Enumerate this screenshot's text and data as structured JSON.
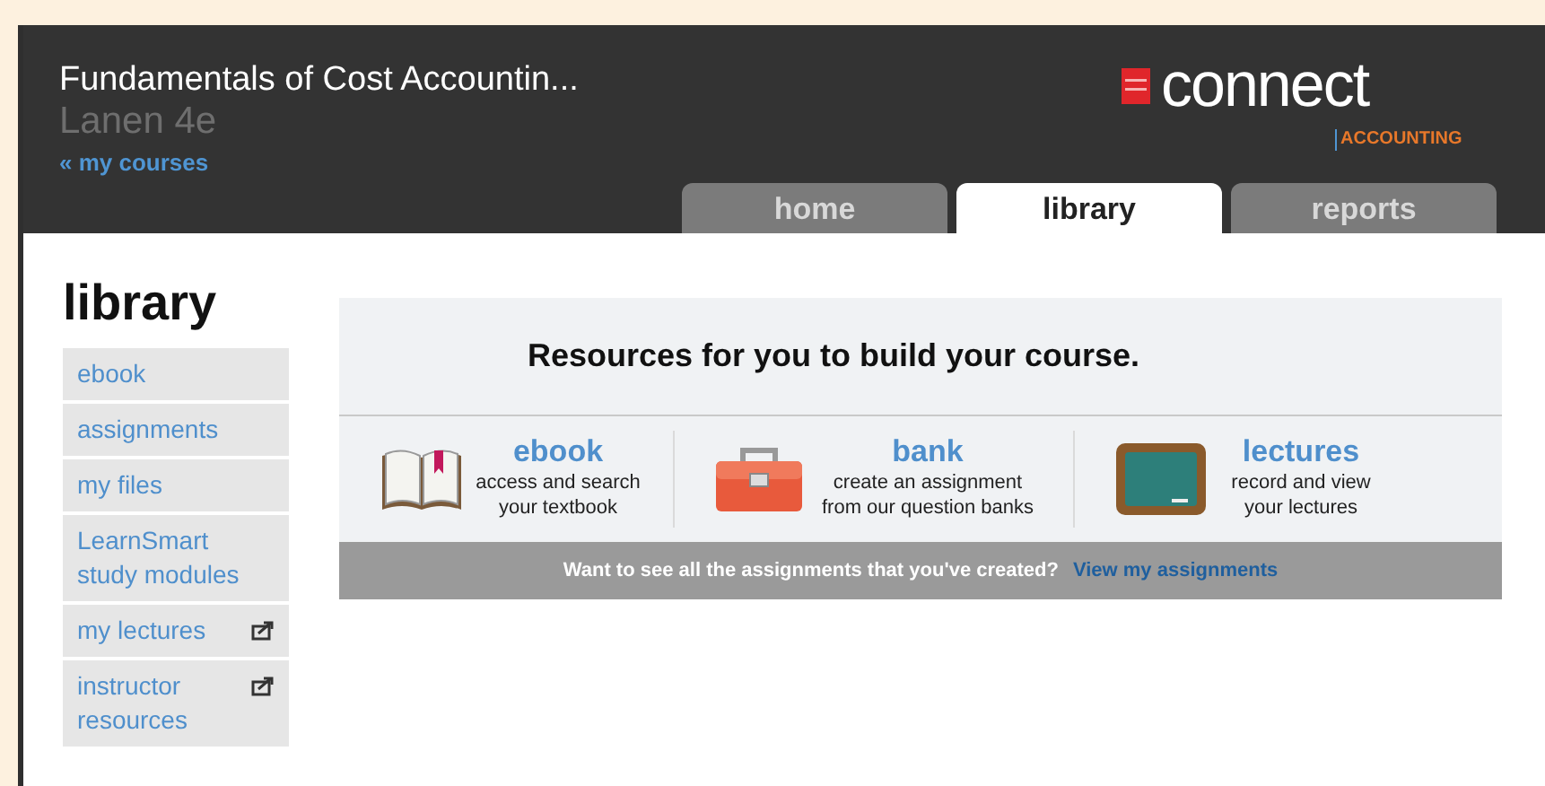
{
  "header": {
    "course_title": "Fundamentals of Cost Accountin...",
    "course_subtitle": "Lanen 4e",
    "back_link": "« my courses",
    "logo": {
      "wordmark": "connect",
      "product": "ACCOUNTING"
    }
  },
  "tabs": [
    {
      "label": "home",
      "selected": false
    },
    {
      "label": "library",
      "selected": true
    },
    {
      "label": "reports",
      "selected": false
    }
  ],
  "page_title": "library",
  "sidebar": {
    "items": [
      {
        "label": "ebook",
        "external": false
      },
      {
        "label": "assignments",
        "external": false
      },
      {
        "label": "my files",
        "external": false
      },
      {
        "label": "LearnSmart study modules",
        "external": false
      },
      {
        "label": "my lectures",
        "external": true
      },
      {
        "label": "instructor resources",
        "external": true
      }
    ]
  },
  "resources": {
    "heading": "Resources for you to build your course.",
    "items": [
      {
        "kind": "book",
        "title": "ebook",
        "description": "access and search your textbook"
      },
      {
        "kind": "toolbox",
        "title": "bank",
        "description": "create an assignment from our question banks"
      },
      {
        "kind": "chalkboard",
        "title": "lectures",
        "description": "record and view your lectures"
      }
    ],
    "footer_text": "Want to see all the assignments that you've created?",
    "footer_link": "View my assignments"
  }
}
